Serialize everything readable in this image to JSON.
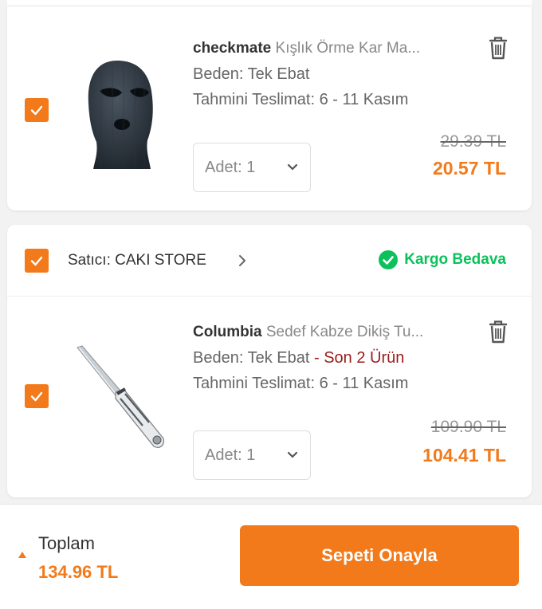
{
  "items": [
    {
      "brand": "checkmate",
      "name": "Kışlık Örme Kar Ma...",
      "size": "Beden: Tek Ebat",
      "stock": "",
      "delivery": "Tahmini Teslimat: 6 - 11 Kasım",
      "qty": "Adet: 1",
      "old_price": "29.39 TL",
      "price": "20.57 TL",
      "icon": "balaclava-image"
    },
    {
      "brand": "Columbia",
      "name": "Sedef Kabze Dikiş Tu...",
      "size": "Beden: Tek Ebat",
      "stock_sep": " - ",
      "stock": "Son 2 Ürün",
      "delivery": "Tahmini Teslimat: 6 - 11 Kasım",
      "qty": "Adet: 1",
      "old_price": "109.90 TL",
      "price": "104.41 TL",
      "icon": "knife-image"
    }
  ],
  "seller": {
    "label": "Satıcı: CAKI STORE",
    "shipping": "Kargo Bedava"
  },
  "footer": {
    "total_label": "Toplam",
    "total_value": "134.96 TL",
    "confirm_label": "Sepeti Onayla"
  },
  "colors": {
    "accent": "#f27a1a",
    "success": "#0bc15c",
    "stock_warning": "#9b1b1b"
  }
}
